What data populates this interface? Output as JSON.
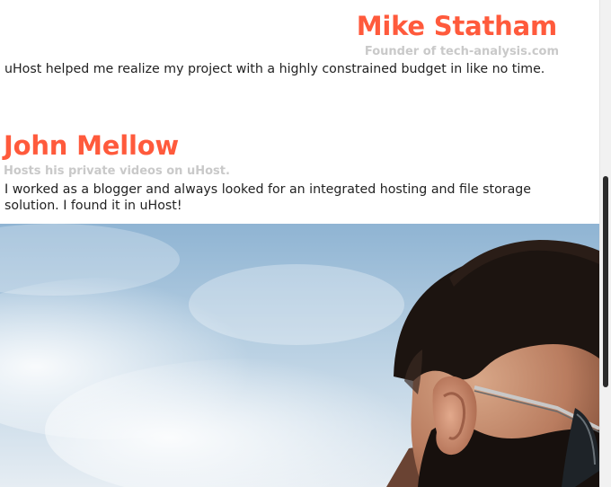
{
  "colors": {
    "accent": "#ff5a3c",
    "subtitle": "#c9c9c9",
    "body_text": "#222222",
    "sky": "#a9c6de"
  },
  "testimonials": [
    {
      "name": "Mike Statham",
      "subtitle": "Founder of tech-analysis.com",
      "quote": "uHost helped me realize my project with a highly constrained budget in like no time."
    },
    {
      "name": "John Mellow",
      "subtitle": "Hosts his private videos on uHost.",
      "quote": "I worked as a blogger and always looked for an integrated hosting and file storage solution. I found it in uHost!"
    }
  ],
  "image": {
    "icon": "customer-photo"
  }
}
